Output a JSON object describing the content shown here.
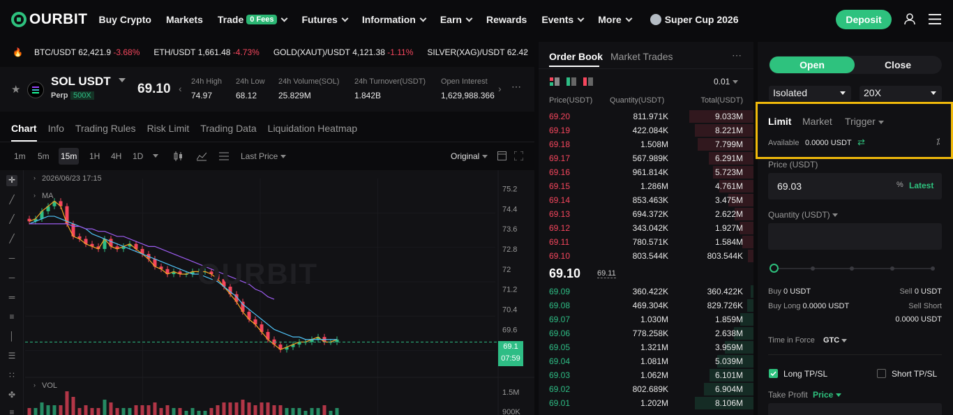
{
  "header": {
    "logo_text": "OURBIT",
    "nav": [
      {
        "label": "Buy Crypto",
        "has_menu": false
      },
      {
        "label": "Markets",
        "has_menu": false
      },
      {
        "label": "Trade",
        "badge": "0 Fees",
        "has_menu": true
      },
      {
        "label": "Futures",
        "has_menu": true
      },
      {
        "label": "Information",
        "has_menu": true
      },
      {
        "label": "Earn",
        "has_menu": true
      },
      {
        "label": "Rewards",
        "has_menu": false
      },
      {
        "label": "Events",
        "has_menu": true
      },
      {
        "label": "More",
        "has_menu": true
      }
    ],
    "promo": "Super Cup 2026",
    "deposit_label": "Deposit",
    "icons": [
      "user-icon",
      "menu-icon"
    ]
  },
  "ticker": [
    {
      "pair": "BTC/USDT",
      "price": "62,421.9",
      "change": "-3.68%"
    },
    {
      "pair": "ETH/USDT",
      "price": "1,661.48",
      "change": "-4.73%"
    },
    {
      "pair": "GOLD(XAUT)/USDT",
      "price": "4,121.38",
      "change": "-1.11%"
    },
    {
      "pair": "SILVER(XAG)/USDT",
      "price": "62.42",
      "change": ""
    }
  ],
  "symbol": {
    "name": "SOL USDT",
    "type": "Perp",
    "leverage": "500X",
    "price": "69.10",
    "stats": [
      {
        "label": "24h High",
        "value": "74.97"
      },
      {
        "label": "24h Low",
        "value": "68.12"
      },
      {
        "label": "24h Volume(SOL)",
        "value": "25.829M"
      },
      {
        "label": "24h Turnover(USDT)",
        "value": "1.842B"
      },
      {
        "label": "Open Interest",
        "value": "1,629,988.366"
      }
    ]
  },
  "chart_tabs": [
    "Chart",
    "Info",
    "Trading Rules",
    "Risk Limit",
    "Trading Data",
    "Liquidation Heatmap"
  ],
  "toolbar": {
    "intervals": [
      "1m",
      "5m",
      "15m",
      "1H",
      "4H",
      "1D"
    ],
    "active_interval": "15m",
    "price_type": "Last Price",
    "view": "Original"
  },
  "chart": {
    "crosshair_time": "2026/06/23 17:15",
    "ma_label": "MA",
    "vol_label": "VOL",
    "watermark": "OURBIT",
    "y_ticks": [
      "75.2",
      "74.4",
      "73.6",
      "72.8",
      "72",
      "71.2",
      "70.4",
      "69.6"
    ],
    "vol_ticks": [
      "1.5M",
      "900K"
    ],
    "last_price_label": "69.1",
    "countdown": "07:59",
    "colors": {
      "up": "#2ebd85",
      "down": "#f6465d",
      "ma_short": "#f5a623",
      "ma_mid": "#4fc3f7",
      "ma_long": "#9c5cf0"
    }
  },
  "chart_data": {
    "type": "line",
    "title": "",
    "x": [
      1,
      2,
      3,
      4,
      5,
      6,
      7,
      8,
      9,
      10,
      11,
      12,
      13,
      14,
      15,
      16,
      17,
      18,
      19,
      20,
      21,
      22,
      23,
      24,
      25,
      26,
      27,
      28,
      29,
      30,
      31,
      32,
      33,
      34,
      35,
      36,
      37,
      38,
      39,
      40,
      41,
      42,
      43,
      44,
      45,
      46,
      47,
      48,
      49,
      50,
      51,
      52,
      53,
      54,
      55,
      56,
      57,
      58,
      59,
      60
    ],
    "series": [
      {
        "values": [
          73.9,
          74.0,
          74.3,
          74.5,
          74.7,
          74.5,
          73.8,
          73.3,
          73.2,
          73.0,
          72.9,
          72.8,
          73.2,
          72.9,
          72.8,
          72.9,
          73.0,
          72.8,
          72.6,
          72.4,
          72.1,
          72.0,
          71.8,
          71.9,
          71.8,
          71.8,
          71.9,
          71.9,
          71.9,
          71.8,
          71.6,
          71.3,
          71.0,
          70.7,
          70.3,
          70.0,
          69.8,
          69.5,
          69.2,
          69.0,
          68.8,
          68.9,
          69.0,
          69.1,
          69.1,
          69.2,
          69.3,
          69.1,
          69.1,
          69.2
        ]
      },
      {
        "values": [
          73.8,
          73.9,
          74.0,
          74.1,
          74.1,
          74.0,
          73.9,
          73.8,
          73.7,
          73.6,
          73.4,
          73.3,
          73.2,
          73.1,
          73.0,
          72.9,
          72.8,
          72.7,
          72.6,
          72.5,
          72.4,
          72.3,
          72.2,
          72.1,
          72.0,
          71.9,
          71.8,
          71.8,
          71.7,
          71.6,
          71.5,
          71.3,
          71.1,
          70.9,
          70.6,
          70.4,
          70.2,
          70.0,
          69.8,
          69.6,
          69.5,
          69.4,
          69.3,
          69.3,
          69.2,
          69.2,
          69.2,
          69.2,
          69.2,
          69.2
        ]
      },
      {
        "values": [
          73.8,
          73.8,
          73.8,
          73.8,
          73.8,
          73.8,
          73.8,
          73.7,
          73.7,
          73.6,
          73.6,
          73.5,
          73.5,
          73.4,
          73.3,
          73.3,
          73.2,
          73.1,
          73.0,
          72.9,
          72.9,
          72.8,
          72.7,
          72.6,
          72.5,
          72.4,
          72.3,
          72.2,
          72.1,
          72.0,
          71.9,
          71.8,
          71.7,
          71.6,
          71.5,
          71.4,
          71.2,
          71.1,
          70.9,
          70.8
        ]
      }
    ],
    "ylim": [
      68.0,
      75.6
    ]
  },
  "orderbook": {
    "tabs": [
      "Order Book",
      "Market Trades"
    ],
    "precision": "0.01",
    "headers": {
      "price": "Price(USDT)",
      "qty": "Quantity(USDT)",
      "total": "Total(USDT)"
    },
    "asks": [
      {
        "price": "69.20",
        "qty": "811.971K",
        "total": "9.033M",
        "depth": 0.92
      },
      {
        "price": "69.19",
        "qty": "422.084K",
        "total": "8.221M",
        "depth": 0.84
      },
      {
        "price": "69.18",
        "qty": "1.508M",
        "total": "7.799M",
        "depth": 0.8
      },
      {
        "price": "69.17",
        "qty": "567.989K",
        "total": "6.291M",
        "depth": 0.64
      },
      {
        "price": "69.16",
        "qty": "961.814K",
        "total": "5.723M",
        "depth": 0.58
      },
      {
        "price": "69.15",
        "qty": "1.286M",
        "total": "4.761M",
        "depth": 0.49
      },
      {
        "price": "69.14",
        "qty": "853.463K",
        "total": "3.475M",
        "depth": 0.36
      },
      {
        "price": "69.13",
        "qty": "694.372K",
        "total": "2.622M",
        "depth": 0.27
      },
      {
        "price": "69.12",
        "qty": "343.042K",
        "total": "1.927M",
        "depth": 0.2
      },
      {
        "price": "69.11",
        "qty": "780.571K",
        "total": "1.584M",
        "depth": 0.16
      },
      {
        "price": "69.10",
        "qty": "803.544K",
        "total": "803.544K",
        "depth": 0.08
      }
    ],
    "last_price": "69.10",
    "mark_price": "69.11",
    "bids": [
      {
        "price": "69.09",
        "qty": "360.422K",
        "total": "360.422K",
        "depth": 0.04
      },
      {
        "price": "69.08",
        "qty": "469.304K",
        "total": "829.726K",
        "depth": 0.09
      },
      {
        "price": "69.07",
        "qty": "1.030M",
        "total": "1.859M",
        "depth": 0.19
      },
      {
        "price": "69.06",
        "qty": "778.258K",
        "total": "2.638M",
        "depth": 0.28
      },
      {
        "price": "69.05",
        "qty": "1.321M",
        "total": "3.959M",
        "depth": 0.41
      },
      {
        "price": "69.04",
        "qty": "1.081M",
        "total": "5.039M",
        "depth": 0.52
      },
      {
        "price": "69.03",
        "qty": "1.062M",
        "total": "6.101M",
        "depth": 0.63
      },
      {
        "price": "69.02",
        "qty": "802.689K",
        "total": "6.904M",
        "depth": 0.71
      },
      {
        "price": "69.01",
        "qty": "1.202M",
        "total": "8.106M",
        "depth": 0.84
      }
    ]
  },
  "panel": {
    "open_label": "Open",
    "close_label": "Close",
    "margin_mode": "Isolated",
    "leverage": "20X",
    "order_types": [
      "Limit",
      "Market",
      "Trigger"
    ],
    "available_label": "Available",
    "available_value": "0.0000 USDT",
    "price_label": "Price (USDT)",
    "price_value": "69.03",
    "latest_label": "Latest",
    "quantity_label": "Quantity (USDT)",
    "buy_label": "Buy",
    "buy_value": "0 USDT",
    "sell_label": "Sell",
    "sell_value": "0 USDT",
    "buy_long_label": "Buy Long",
    "buy_long_value": "0.0000 USDT",
    "sell_short_label": "Sell Short",
    "sell_short_value": "0.0000 USDT",
    "tif_label": "Time in Force",
    "tif_value": "GTC",
    "long_tpsl": "Long TP/SL",
    "short_tpsl": "Short TP/SL",
    "long_tpsl_checked": true,
    "take_profit_label": "Take Profit",
    "take_profit_mode": "Price",
    "accent": "#2ec27e",
    "highlight": "#f0b90b"
  }
}
